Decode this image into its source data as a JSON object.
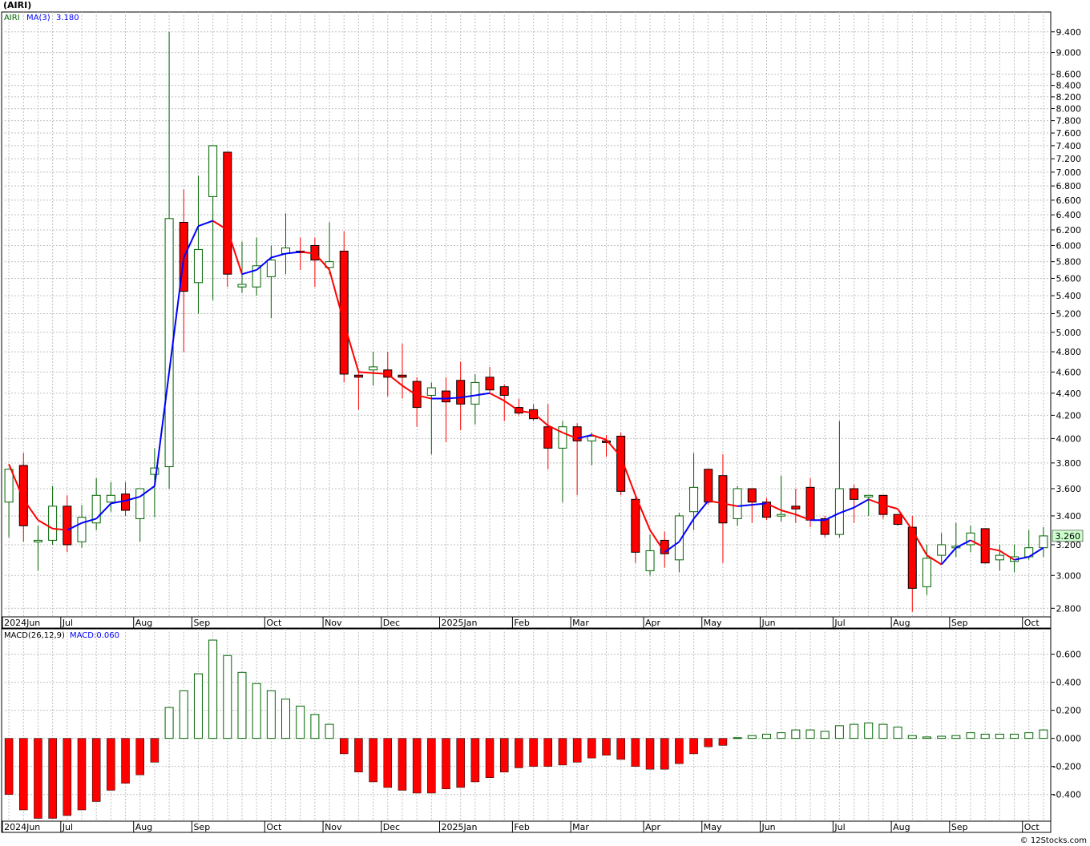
{
  "page": {
    "title": "(AIRI)",
    "watermark": "© 12Stocks.com"
  },
  "colors": {
    "up": "#006400",
    "down": "#ff0000",
    "ma_up": "#0000ff",
    "ma_down": "#ff0000",
    "grid": "#c0c0c0",
    "last_price_box": "#ccffcc"
  },
  "chart_data": [
    {
      "type": "candlestick",
      "panel": "price",
      "symbol_label": "AIRI",
      "ma_label": "MA(3)",
      "ma_value": "3.180",
      "last_price_label": "3.260",
      "ylim": [
        2.75,
        9.8
      ],
      "y_scale": "log",
      "y_ticks": [
        9.4,
        9.0,
        8.6,
        8.4,
        8.2,
        8.0,
        7.8,
        7.6,
        7.4,
        7.2,
        7.0,
        6.8,
        6.6,
        6.4,
        6.2,
        6.0,
        5.8,
        5.6,
        5.4,
        5.2,
        5.0,
        4.8,
        4.6,
        4.4,
        4.2,
        4.0,
        3.8,
        3.6,
        3.4,
        3.2,
        3.0,
        2.8
      ],
      "y_tick_labels": [
        "9.400",
        "9.000",
        "8.600",
        "8.400",
        "8.200",
        "8.000",
        "7.800",
        "7.600",
        "7.400",
        "7.200",
        "7.000",
        "6.800",
        "6.600",
        "6.400",
        "6.200",
        "6.000",
        "5.800",
        "5.600",
        "5.400",
        "5.200",
        "5.000",
        "4.800",
        "4.600",
        "4.400",
        "4.200",
        "4.000",
        "3.800",
        "3.600",
        "3.400",
        "3.200",
        "3.000",
        "2.800"
      ],
      "x_labels": [
        {
          "label": "2024Jun",
          "bar": 0
        },
        {
          "label": "Jul",
          "bar": 4
        },
        {
          "label": "Aug",
          "bar": 9
        },
        {
          "label": "Sep",
          "bar": 13
        },
        {
          "label": "Oct",
          "bar": 18
        },
        {
          "label": "Nov",
          "bar": 22
        },
        {
          "label": "Dec",
          "bar": 26
        },
        {
          "label": "2025Jan",
          "bar": 30
        },
        {
          "label": "Feb",
          "bar": 35
        },
        {
          "label": "Mar",
          "bar": 39
        },
        {
          "label": "Apr",
          "bar": 44
        },
        {
          "label": "May",
          "bar": 48
        },
        {
          "label": "Jun",
          "bar": 52
        },
        {
          "label": "Jul",
          "bar": 57
        },
        {
          "label": "Aug",
          "bar": 61
        },
        {
          "label": "Sep",
          "bar": 65
        },
        {
          "label": "Oct",
          "bar": 70
        }
      ],
      "candles": [
        {
          "o": 3.5,
          "h": 3.72,
          "l": 3.25,
          "c": 3.75
        },
        {
          "o": 3.78,
          "h": 3.88,
          "l": 3.22,
          "c": 3.33
        },
        {
          "o": 3.23,
          "h": 3.33,
          "l": 3.03,
          "c": 3.23
        },
        {
          "o": 3.23,
          "h": 3.62,
          "l": 3.2,
          "c": 3.47
        },
        {
          "o": 3.47,
          "h": 3.55,
          "l": 3.15,
          "c": 3.2
        },
        {
          "o": 3.22,
          "h": 3.48,
          "l": 3.18,
          "c": 3.39
        },
        {
          "o": 3.35,
          "h": 3.68,
          "l": 3.3,
          "c": 3.55
        },
        {
          "o": 3.5,
          "h": 3.65,
          "l": 3.43,
          "c": 3.55
        },
        {
          "o": 3.56,
          "h": 3.65,
          "l": 3.4,
          "c": 3.44
        },
        {
          "o": 3.38,
          "h": 3.55,
          "l": 3.22,
          "c": 3.6
        },
        {
          "o": 3.71,
          "h": 3.92,
          "l": 3.39,
          "c": 3.76
        },
        {
          "o": 3.77,
          "h": 9.4,
          "l": 3.6,
          "c": 6.35
        },
        {
          "o": 6.3,
          "h": 6.75,
          "l": 4.8,
          "c": 5.45
        },
        {
          "o": 5.55,
          "h": 6.95,
          "l": 5.2,
          "c": 5.95
        },
        {
          "o": 6.65,
          "h": 7.4,
          "l": 5.35,
          "c": 7.4
        },
        {
          "o": 7.3,
          "h": 7.3,
          "l": 5.5,
          "c": 5.65
        },
        {
          "o": 5.5,
          "h": 6.05,
          "l": 5.43,
          "c": 5.53
        },
        {
          "o": 5.5,
          "h": 6.1,
          "l": 5.4,
          "c": 5.75
        },
        {
          "o": 5.62,
          "h": 6.0,
          "l": 5.15,
          "c": 5.82
        },
        {
          "o": 5.9,
          "h": 6.42,
          "l": 5.65,
          "c": 5.97
        },
        {
          "o": 5.93,
          "h": 6.1,
          "l": 5.7,
          "c": 5.92
        },
        {
          "o": 6.0,
          "h": 6.1,
          "l": 5.5,
          "c": 5.82
        },
        {
          "o": 5.73,
          "h": 6.3,
          "l": 5.65,
          "c": 5.8
        },
        {
          "o": 5.93,
          "h": 6.18,
          "l": 4.5,
          "c": 4.58
        },
        {
          "o": 4.57,
          "h": 4.6,
          "l": 4.25,
          "c": 4.55
        },
        {
          "o": 4.62,
          "h": 4.8,
          "l": 4.47,
          "c": 4.65
        },
        {
          "o": 4.62,
          "h": 4.8,
          "l": 4.37,
          "c": 4.55
        },
        {
          "o": 4.57,
          "h": 4.88,
          "l": 4.35,
          "c": 4.55
        },
        {
          "o": 4.51,
          "h": 4.55,
          "l": 4.1,
          "c": 4.27
        },
        {
          "o": 4.38,
          "h": 4.5,
          "l": 3.87,
          "c": 4.45
        },
        {
          "o": 4.42,
          "h": 4.55,
          "l": 3.97,
          "c": 4.32
        },
        {
          "o": 4.52,
          "h": 4.7,
          "l": 4.07,
          "c": 4.3
        },
        {
          "o": 4.3,
          "h": 4.58,
          "l": 4.12,
          "c": 4.5
        },
        {
          "o": 4.55,
          "h": 4.65,
          "l": 4.4,
          "c": 4.43
        },
        {
          "o": 4.46,
          "h": 4.48,
          "l": 4.15,
          "c": 4.38
        },
        {
          "o": 4.27,
          "h": 4.35,
          "l": 4.2,
          "c": 4.22
        },
        {
          "o": 4.25,
          "h": 4.3,
          "l": 4.15,
          "c": 4.17
        },
        {
          "o": 4.1,
          "h": 4.3,
          "l": 3.75,
          "c": 3.92
        },
        {
          "o": 3.92,
          "h": 4.15,
          "l": 3.5,
          "c": 4.1
        },
        {
          "o": 4.1,
          "h": 4.13,
          "l": 3.55,
          "c": 3.98
        },
        {
          "o": 3.98,
          "h": 4.05,
          "l": 3.78,
          "c": 4.02
        },
        {
          "o": 3.98,
          "h": 4.03,
          "l": 3.85,
          "c": 3.97
        },
        {
          "o": 4.02,
          "h": 4.05,
          "l": 3.55,
          "c": 3.58
        },
        {
          "o": 3.52,
          "h": 3.55,
          "l": 3.08,
          "c": 3.15
        },
        {
          "o": 3.03,
          "h": 3.27,
          "l": 3.0,
          "c": 3.16
        },
        {
          "o": 3.23,
          "h": 3.29,
          "l": 3.05,
          "c": 3.14
        },
        {
          "o": 3.1,
          "h": 3.42,
          "l": 3.02,
          "c": 3.4
        },
        {
          "o": 3.43,
          "h": 3.88,
          "l": 3.3,
          "c": 3.61
        },
        {
          "o": 3.75,
          "h": 3.75,
          "l": 3.48,
          "c": 3.5
        },
        {
          "o": 3.7,
          "h": 3.87,
          "l": 3.08,
          "c": 3.35
        },
        {
          "o": 3.38,
          "h": 3.62,
          "l": 3.33,
          "c": 3.6
        },
        {
          "o": 3.6,
          "h": 3.6,
          "l": 3.35,
          "c": 3.5
        },
        {
          "o": 3.5,
          "h": 3.53,
          "l": 3.37,
          "c": 3.39
        },
        {
          "o": 3.4,
          "h": 3.7,
          "l": 3.36,
          "c": 3.41
        },
        {
          "o": 3.47,
          "h": 3.6,
          "l": 3.35,
          "c": 3.45
        },
        {
          "o": 3.61,
          "h": 3.68,
          "l": 3.32,
          "c": 3.37
        },
        {
          "o": 3.38,
          "h": 3.4,
          "l": 3.25,
          "c": 3.27
        },
        {
          "o": 3.27,
          "h": 4.15,
          "l": 3.25,
          "c": 3.6
        },
        {
          "o": 3.6,
          "h": 3.63,
          "l": 3.35,
          "c": 3.52
        },
        {
          "o": 3.55,
          "h": 3.55,
          "l": 3.4,
          "c": 3.55
        },
        {
          "o": 3.55,
          "h": 3.55,
          "l": 3.38,
          "c": 3.41
        },
        {
          "o": 3.41,
          "h": 3.41,
          "l": 3.33,
          "c": 3.34
        },
        {
          "o": 3.32,
          "h": 3.4,
          "l": 2.78,
          "c": 2.92
        },
        {
          "o": 2.93,
          "h": 3.2,
          "l": 2.88,
          "c": 3.11
        },
        {
          "o": 3.13,
          "h": 3.28,
          "l": 3.08,
          "c": 3.2
        },
        {
          "o": 3.18,
          "h": 3.35,
          "l": 3.12,
          "c": 3.19
        },
        {
          "o": 3.2,
          "h": 3.33,
          "l": 3.15,
          "c": 3.28
        },
        {
          "o": 3.31,
          "h": 3.31,
          "l": 3.08,
          "c": 3.08
        },
        {
          "o": 3.1,
          "h": 3.2,
          "l": 3.03,
          "c": 3.13
        },
        {
          "o": 3.09,
          "h": 3.2,
          "l": 3.02,
          "c": 3.12
        },
        {
          "o": 3.12,
          "h": 3.3,
          "l": 3.1,
          "c": 3.18
        },
        {
          "o": 3.18,
          "h": 3.32,
          "l": 3.12,
          "c": 3.26
        }
      ],
      "ma": [
        3.79,
        3.52,
        3.37,
        3.31,
        3.3,
        3.35,
        3.38,
        3.49,
        3.51,
        3.54,
        3.62,
        4.6,
        5.85,
        6.25,
        6.32,
        6.2,
        5.65,
        5.7,
        5.85,
        5.9,
        5.92,
        5.9,
        5.7,
        5.1,
        4.6,
        4.59,
        4.58,
        4.47,
        4.38,
        4.35,
        4.35,
        4.36,
        4.38,
        4.4,
        4.33,
        4.24,
        4.22,
        4.11,
        4.05,
        4.0,
        4.03,
        3.99,
        3.85,
        3.55,
        3.3,
        3.15,
        3.22,
        3.38,
        3.51,
        3.49,
        3.47,
        3.48,
        3.49,
        3.44,
        3.41,
        3.37,
        3.37,
        3.42,
        3.46,
        3.52,
        3.48,
        3.45,
        3.3,
        3.13,
        3.07,
        3.18,
        3.23,
        3.18,
        3.16,
        3.1,
        3.12,
        3.18
      ]
    },
    {
      "type": "bar",
      "panel": "macd",
      "label": "MACD(26,12,9)",
      "value_label": "MACD:0.060",
      "ylim": [
        -0.59,
        0.78
      ],
      "y_ticks": [
        0.6,
        0.4,
        0.2,
        0.0,
        -0.2,
        -0.4
      ],
      "y_tick_labels": [
        "0.600",
        "0.400",
        "0.200",
        "0.000",
        "-0.200",
        "-0.400"
      ],
      "values": [
        -0.4,
        -0.51,
        -0.57,
        -0.57,
        -0.55,
        -0.51,
        -0.45,
        -0.37,
        -0.32,
        -0.26,
        -0.17,
        0.22,
        0.34,
        0.46,
        0.7,
        0.59,
        0.47,
        0.39,
        0.34,
        0.28,
        0.23,
        0.17,
        0.1,
        -0.11,
        -0.24,
        -0.31,
        -0.35,
        -0.37,
        -0.39,
        -0.39,
        -0.36,
        -0.35,
        -0.31,
        -0.28,
        -0.24,
        -0.21,
        -0.2,
        -0.2,
        -0.19,
        -0.17,
        -0.14,
        -0.12,
        -0.15,
        -0.2,
        -0.22,
        -0.22,
        -0.18,
        -0.11,
        -0.06,
        -0.05,
        0.005,
        0.02,
        0.03,
        0.04,
        0.06,
        0.06,
        0.05,
        0.09,
        0.1,
        0.11,
        0.1,
        0.08,
        0.02,
        0.01,
        0.015,
        0.02,
        0.04,
        0.03,
        0.03,
        0.03,
        0.04,
        0.06
      ],
      "x_labels": [
        {
          "label": "2024Jun",
          "bar": 0
        },
        {
          "label": "Jul",
          "bar": 4
        },
        {
          "label": "Aug",
          "bar": 9
        },
        {
          "label": "Sep",
          "bar": 13
        },
        {
          "label": "Oct",
          "bar": 18
        },
        {
          "label": "Nov",
          "bar": 22
        },
        {
          "label": "Dec",
          "bar": 26
        },
        {
          "label": "2025Jan",
          "bar": 30
        },
        {
          "label": "Feb",
          "bar": 35
        },
        {
          "label": "Mar",
          "bar": 39
        },
        {
          "label": "Apr",
          "bar": 44
        },
        {
          "label": "May",
          "bar": 48
        },
        {
          "label": "Jun",
          "bar": 52
        },
        {
          "label": "Jul",
          "bar": 57
        },
        {
          "label": "Aug",
          "bar": 61
        },
        {
          "label": "Sep",
          "bar": 65
        },
        {
          "label": "Oct",
          "bar": 70
        }
      ]
    }
  ]
}
